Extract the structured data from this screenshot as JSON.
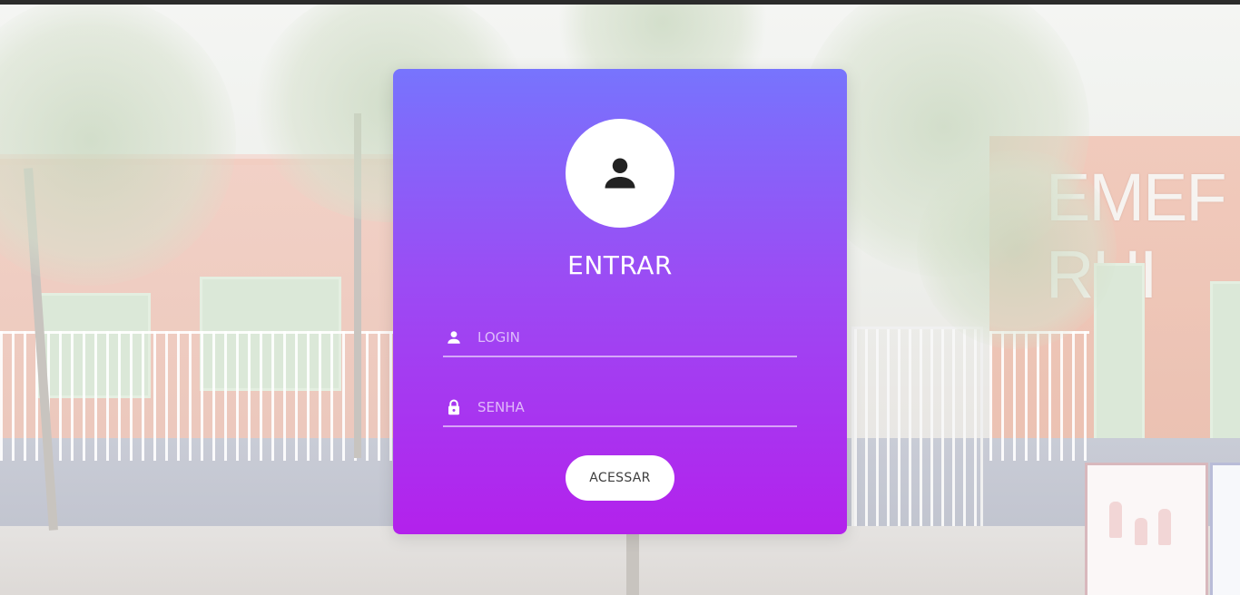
{
  "login_card": {
    "avatar_icon": "user-icon",
    "title": "ENTRAR",
    "login_field": {
      "icon": "user-icon",
      "placeholder": "LOGIN",
      "value": ""
    },
    "password_field": {
      "icon": "lock-icon",
      "placeholder": "SENHA",
      "value": ""
    },
    "submit_label": "ACESSAR"
  },
  "background": {
    "building_sign": "EMEF RUI"
  },
  "colors": {
    "card_gradient_top": "#7774fd",
    "card_gradient_bottom": "#b321ec",
    "button_bg": "#ffffff",
    "button_text": "#3e3e3e"
  }
}
